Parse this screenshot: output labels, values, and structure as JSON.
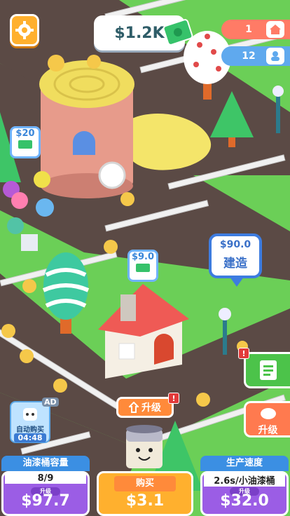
{
  "cash": "$1.2K",
  "stats": [
    {
      "value": "1",
      "icon": "house-icon",
      "color": "#ff7b66"
    },
    {
      "value": "12",
      "icon": "customers-icon",
      "color": "#5fa9ee"
    }
  ],
  "price_tags": {
    "tower": "$20",
    "house": "$9.0"
  },
  "build": {
    "price": "$90.0",
    "label": "建造"
  },
  "upgrade_center": {
    "label": "升级",
    "badge": "!"
  },
  "upgrade_side": {
    "label": "升级"
  },
  "task_badge": "!",
  "auto_buy": {
    "ad": "AD",
    "label": "自动购买",
    "timer": "04:48"
  },
  "panels": [
    {
      "title": "油漆桶容量",
      "sub": "8/9",
      "chip": "升级",
      "price": "$97.7",
      "color": "#9b5de5",
      "title_color": "#3b8fe3"
    },
    {
      "title": "购买",
      "sub": "",
      "chip": "",
      "price": "$3.1",
      "color": "#ffb02e",
      "title_color": "#ff8a3a"
    },
    {
      "title": "生产速度",
      "sub": "2.6s/小油漆桶",
      "chip": "升级",
      "price": "$32.0",
      "color": "#9b5de5",
      "title_color": "#3b8fe3"
    }
  ],
  "colors": {
    "grass": "#6bcf57",
    "road": "#5b4a45",
    "fence": "#f1f1f1"
  }
}
